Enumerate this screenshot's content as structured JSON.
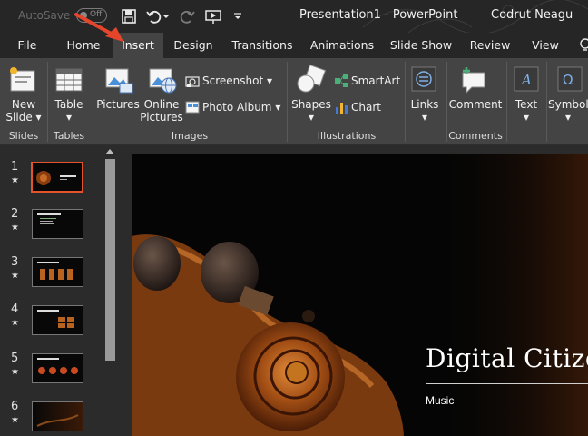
{
  "titlebar": {
    "autosave_label": "AutoSave",
    "autosave_state": "Off",
    "doc_title": "Presentation1 - PowerPoint",
    "user_name": "Codrut Neagu"
  },
  "tabs": [
    {
      "label": "File"
    },
    {
      "label": "Home"
    },
    {
      "label": "Insert"
    },
    {
      "label": "Design"
    },
    {
      "label": "Transitions"
    },
    {
      "label": "Animations"
    },
    {
      "label": "Slide Show"
    },
    {
      "label": "Review"
    },
    {
      "label": "View"
    }
  ],
  "ribbon": {
    "slides": {
      "new_slide_line1": "New",
      "new_slide_line2": "Slide",
      "group": "Slides"
    },
    "tables": {
      "table": "Table",
      "group": "Tables"
    },
    "images": {
      "pictures": "Pictures",
      "online_line1": "Online",
      "online_line2": "Pictures",
      "screenshot": "Screenshot",
      "photo_album": "Photo Album",
      "group": "Images"
    },
    "illustrations": {
      "shapes": "Shapes",
      "smartart": "SmartArt",
      "chart": "Chart",
      "group": "Illustrations"
    },
    "links": {
      "links": "Links"
    },
    "comments": {
      "comment": "Comment",
      "group": "Comments"
    },
    "text": {
      "text": "Text"
    },
    "symbols": {
      "symbols": "Symbols"
    }
  },
  "thumbnails": [
    {
      "number": "1"
    },
    {
      "number": "2"
    },
    {
      "number": "3"
    },
    {
      "number": "4"
    },
    {
      "number": "5"
    },
    {
      "number": "6"
    }
  ],
  "slide": {
    "title": "Digital Citizen",
    "subtitle": "Music"
  },
  "colors": {
    "accent": "#e5532b",
    "ribbon": "#444444",
    "background": "#262626"
  }
}
